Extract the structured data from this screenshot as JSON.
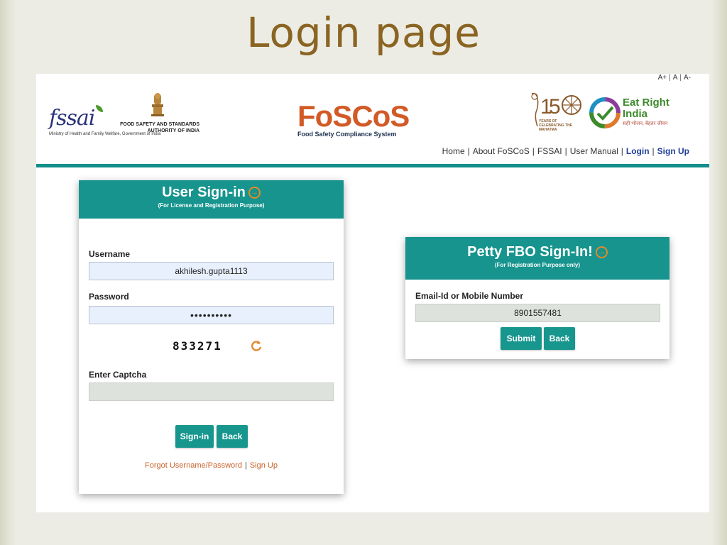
{
  "slide": {
    "title": "Login page"
  },
  "font_size_controls": {
    "increase": "A+",
    "normal": "A",
    "decrease": "A-"
  },
  "header": {
    "fssai": {
      "wordmark": "fssai",
      "authority": "FOOD SAFETY AND STANDARDS AUTHORITY OF INDIA",
      "ministry": "Ministry of Health and Family Welfare, Government of India"
    },
    "foscos": {
      "wordmark": "FoSCoS",
      "tagline": "Food Safety Compliance System"
    },
    "gandhi": {
      "number": "150",
      "text": "YEARS OF CELEBRATING THE MAHATMA"
    },
    "eat_right": {
      "line1": "Eat Right",
      "line2": "India",
      "hindi": "सही भोजन, बेहतर जीवन"
    }
  },
  "nav": {
    "items": [
      {
        "label": "Home",
        "active": false
      },
      {
        "label": "About FoSCoS",
        "active": false
      },
      {
        "label": "FSSAI",
        "active": false
      },
      {
        "label": "User Manual",
        "active": false
      },
      {
        "label": "Login",
        "active": true
      },
      {
        "label": "Sign Up",
        "active": true
      }
    ]
  },
  "user_signin": {
    "title": "User Sign-in",
    "subtitle": "(For License and Registration Purpose)",
    "username_label": "Username",
    "username_value": "akhilesh.gupta1113",
    "password_label": "Password",
    "password_value": "••••••••••",
    "captcha_code": "833271",
    "captcha_label": "Enter Captcha",
    "captcha_value": "",
    "signin_button": "Sign-in",
    "back_button": "Back",
    "forgot_link": "Forgot Username/Password",
    "signup_link": "Sign Up"
  },
  "petty_signin": {
    "title": "Petty FBO Sign-In!",
    "subtitle": "(For Registration Purpose only)",
    "contact_label": "Email-Id or Mobile Number",
    "contact_value": "8901557481",
    "submit_button": "Submit",
    "back_button": "Back"
  },
  "colors": {
    "teal": "#16948d",
    "title_brown": "#8a6422",
    "link_orange": "#c8632a",
    "nav_blue": "#1f3f9a",
    "foscos_orange": "#d25a26"
  },
  "icons": {
    "arrow": "arrow-circle-right-icon",
    "refresh": "refresh-icon",
    "emblem": "national-emblem-icon",
    "charkha": "charkha-icon",
    "eat_right": "eat-right-check-icon"
  }
}
